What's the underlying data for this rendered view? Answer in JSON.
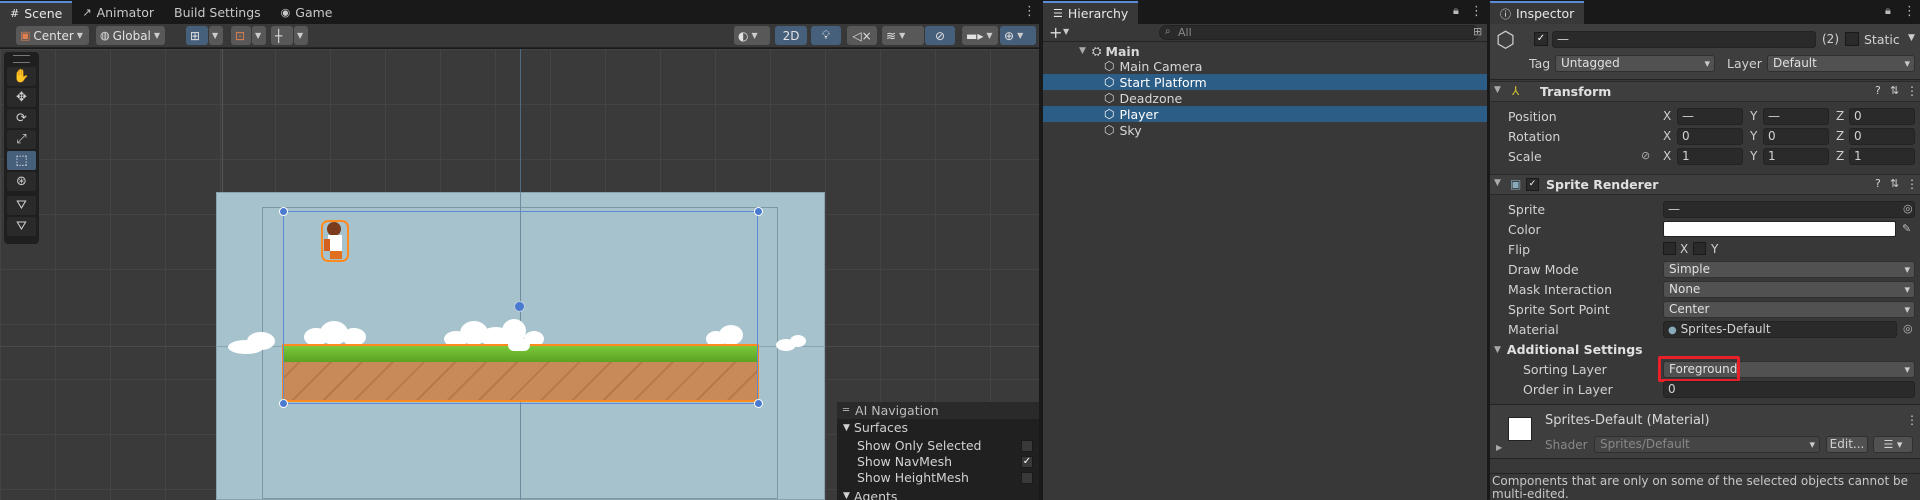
{
  "scene_tabs": [
    {
      "label": "Scene",
      "icon": "hash-grid-icon",
      "active": true
    },
    {
      "label": "Animator",
      "icon": "animator-icon",
      "active": false
    },
    {
      "label": "Build Settings",
      "icon": "",
      "active": false
    },
    {
      "label": "Game",
      "icon": "gamepad-icon",
      "active": false
    }
  ],
  "scene_toolbar": {
    "pivot": "Center",
    "space": "Global",
    "mode_2d": "2D"
  },
  "tools": [
    "hand-tool-icon",
    "move-tool-icon",
    "rotate-tool-icon",
    "scale-tool-icon",
    "rect-tool-icon",
    "transform-tool-icon",
    "custom-tool-icon",
    "custom-tool-2-icon"
  ],
  "overlay": {
    "title": "AI Navigation",
    "section": "Surfaces",
    "items": [
      {
        "label": "Show Only Selected",
        "checked": false
      },
      {
        "label": "Show NavMesh",
        "checked": true
      },
      {
        "label": "Show HeightMesh",
        "checked": false
      }
    ],
    "next_section": "Agents"
  },
  "hierarchy": {
    "tab": "Hierarchy",
    "search_placeholder": "All",
    "scene": "Main",
    "items": [
      {
        "label": "Main Camera",
        "selected": false
      },
      {
        "label": "Start Platform",
        "selected": true
      },
      {
        "label": "Deadzone",
        "selected": false
      },
      {
        "label": "Player",
        "selected": true
      },
      {
        "label": "Sky",
        "selected": false
      }
    ]
  },
  "inspector": {
    "tab": "Inspector",
    "name_value": "—",
    "count": "(2)",
    "static_label": "Static",
    "tag_label": "Tag",
    "tag_value": "Untagged",
    "layer_label": "Layer",
    "layer_value": "Default",
    "transform": {
      "title": "Transform",
      "position_label": "Position",
      "rotation_label": "Rotation",
      "scale_label": "Scale",
      "position": {
        "x": "—",
        "y": "—",
        "z": "0"
      },
      "rotation": {
        "x": "0",
        "y": "0",
        "z": "0"
      },
      "scale": {
        "x": "1",
        "y": "1",
        "z": "1"
      }
    },
    "sprite_renderer": {
      "title": "Sprite Renderer",
      "sprite_label": "Sprite",
      "sprite_value": "—",
      "color_label": "Color",
      "flip_label": "Flip",
      "flip_x": "X",
      "flip_y": "Y",
      "draw_mode_label": "Draw Mode",
      "draw_mode_value": "Simple",
      "mask_label": "Mask Interaction",
      "mask_value": "None",
      "sort_point_label": "Sprite Sort Point",
      "sort_point_value": "Center",
      "material_label": "Material",
      "material_value": "Sprites-Default",
      "additional_label": "Additional Settings",
      "sorting_layer_label": "Sorting Layer",
      "sorting_layer_value": "Foreground",
      "order_label": "Order in Layer",
      "order_value": "0"
    },
    "material": {
      "title": "Sprites-Default (Material)",
      "shader_label": "Shader",
      "shader_value": "Sprites/Default",
      "edit_label": "Edit..."
    },
    "note": "Components that are only on some of the selected objects cannot be multi-edited."
  },
  "colors": {
    "accent_blue": "#46607c",
    "selection": "#2c5d87",
    "highlight_red": "#e8202a",
    "sky": "#a6c2cc",
    "grass": "#6cb82c",
    "dirt": "#c98a5a"
  }
}
